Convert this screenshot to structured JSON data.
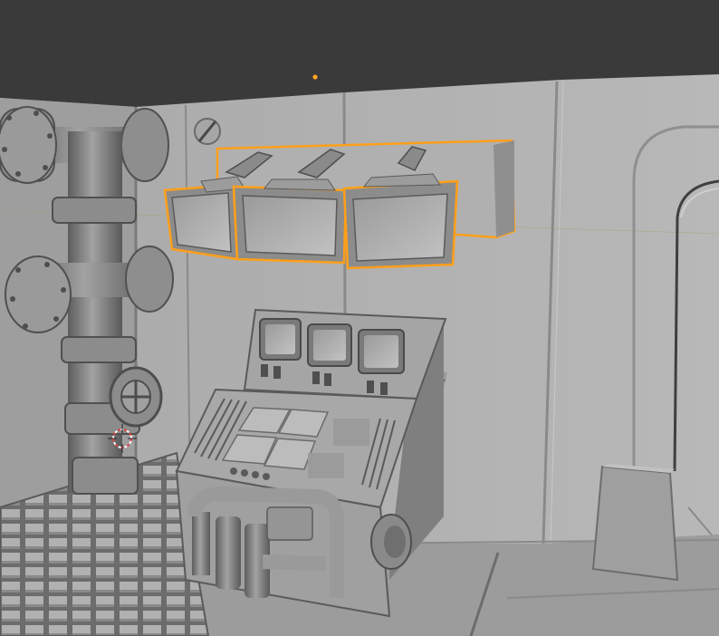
{
  "viewport": {
    "mode": "3D Viewport",
    "background_color": "#3a3a3a",
    "selection_outline_color": "#ff9f1a",
    "origin_dot_color": "#ffa726",
    "cursor_colors": [
      "#e04040",
      "#ffffff"
    ]
  },
  "scene": {
    "objects": [
      {
        "name": "back-wall-panels",
        "selected": false
      },
      {
        "name": "floor-panels",
        "selected": false
      },
      {
        "name": "pipe-column-with-flanges",
        "selected": false
      },
      {
        "name": "valve-wheel",
        "selected": false
      },
      {
        "name": "floor-grate",
        "selected": false
      },
      {
        "name": "monitor-rack",
        "selected": true,
        "monitor_count": 3
      },
      {
        "name": "control-console",
        "selected": false,
        "screen_count": 3
      },
      {
        "name": "wall-conduit",
        "selected": false
      },
      {
        "name": "floor-box",
        "selected": false
      }
    ]
  }
}
